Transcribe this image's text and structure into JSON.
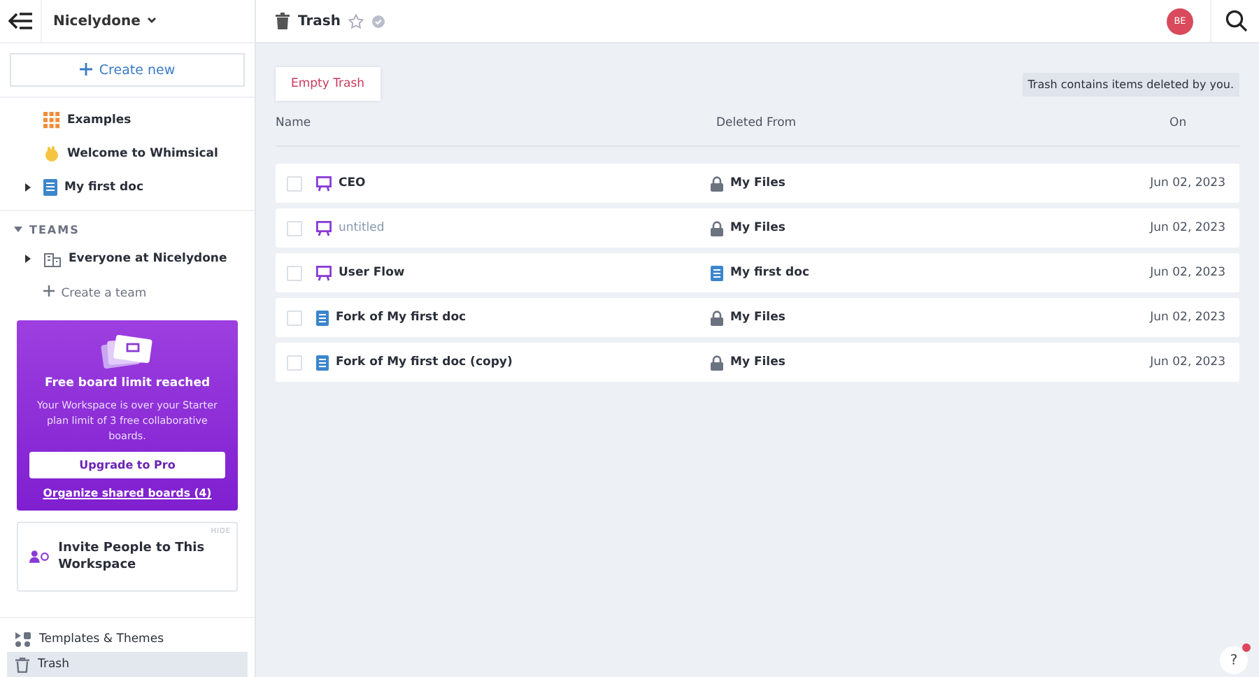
{
  "workspace": {
    "name": "Nicelydone"
  },
  "create_button": "Create new",
  "sidebar": {
    "items": [
      {
        "label": "Examples",
        "kind": "examples"
      },
      {
        "label": "Welcome to Whimsical",
        "kind": "wave"
      },
      {
        "label": "My first doc",
        "kind": "doc",
        "expanded": false
      }
    ],
    "teams": {
      "title": "TEAMS",
      "expanded": true,
      "items": [
        {
          "label": "Everyone at Nicelydone",
          "expanded": false
        }
      ],
      "create": "Create a team"
    },
    "promo": {
      "title": "Free board limit reached",
      "text": "Your Workspace is over your Starter plan limit of 3 free collaborative boards.",
      "button": "Upgrade to Pro",
      "link": "Organize shared boards (4)"
    },
    "invite": {
      "text": "Invite People to This Workspace",
      "hide": "HIDE"
    },
    "bottom": [
      {
        "label": "Templates & Themes",
        "kind": "templates",
        "selected": false
      },
      {
        "label": "Trash",
        "kind": "trash",
        "selected": true
      }
    ]
  },
  "header": {
    "title": "Trash",
    "avatar": "BE"
  },
  "toolbar": {
    "button": "Empty Trash",
    "note": "Trash contains items deleted by you."
  },
  "table": {
    "columns": [
      "Name",
      "Deleted From",
      "On"
    ],
    "rows": [
      {
        "name": "CEO",
        "kind": "board",
        "untitled": false,
        "checked": false,
        "source": {
          "label": "My Files",
          "kind": "folder"
        },
        "date": "Jun 02, 2023"
      },
      {
        "name": "untitled",
        "kind": "board",
        "untitled": true,
        "checked": false,
        "source": {
          "label": "My Files",
          "kind": "folder"
        },
        "date": "Jun 02, 2023"
      },
      {
        "name": "User Flow",
        "kind": "board",
        "untitled": false,
        "checked": false,
        "source": {
          "label": "My first doc",
          "kind": "doc"
        },
        "date": "Jun 02, 2023"
      },
      {
        "name": "Fork of My first doc",
        "kind": "doc",
        "untitled": false,
        "checked": false,
        "source": {
          "label": "My Files",
          "kind": "folder"
        },
        "date": "Jun 02, 2023"
      },
      {
        "name": "Fork of My first doc (copy)",
        "kind": "doc",
        "untitled": false,
        "checked": false,
        "source": {
          "label": "My Files",
          "kind": "folder"
        },
        "date": "Jun 02, 2023"
      }
    ]
  },
  "help": {
    "label": "?",
    "notification": true
  }
}
